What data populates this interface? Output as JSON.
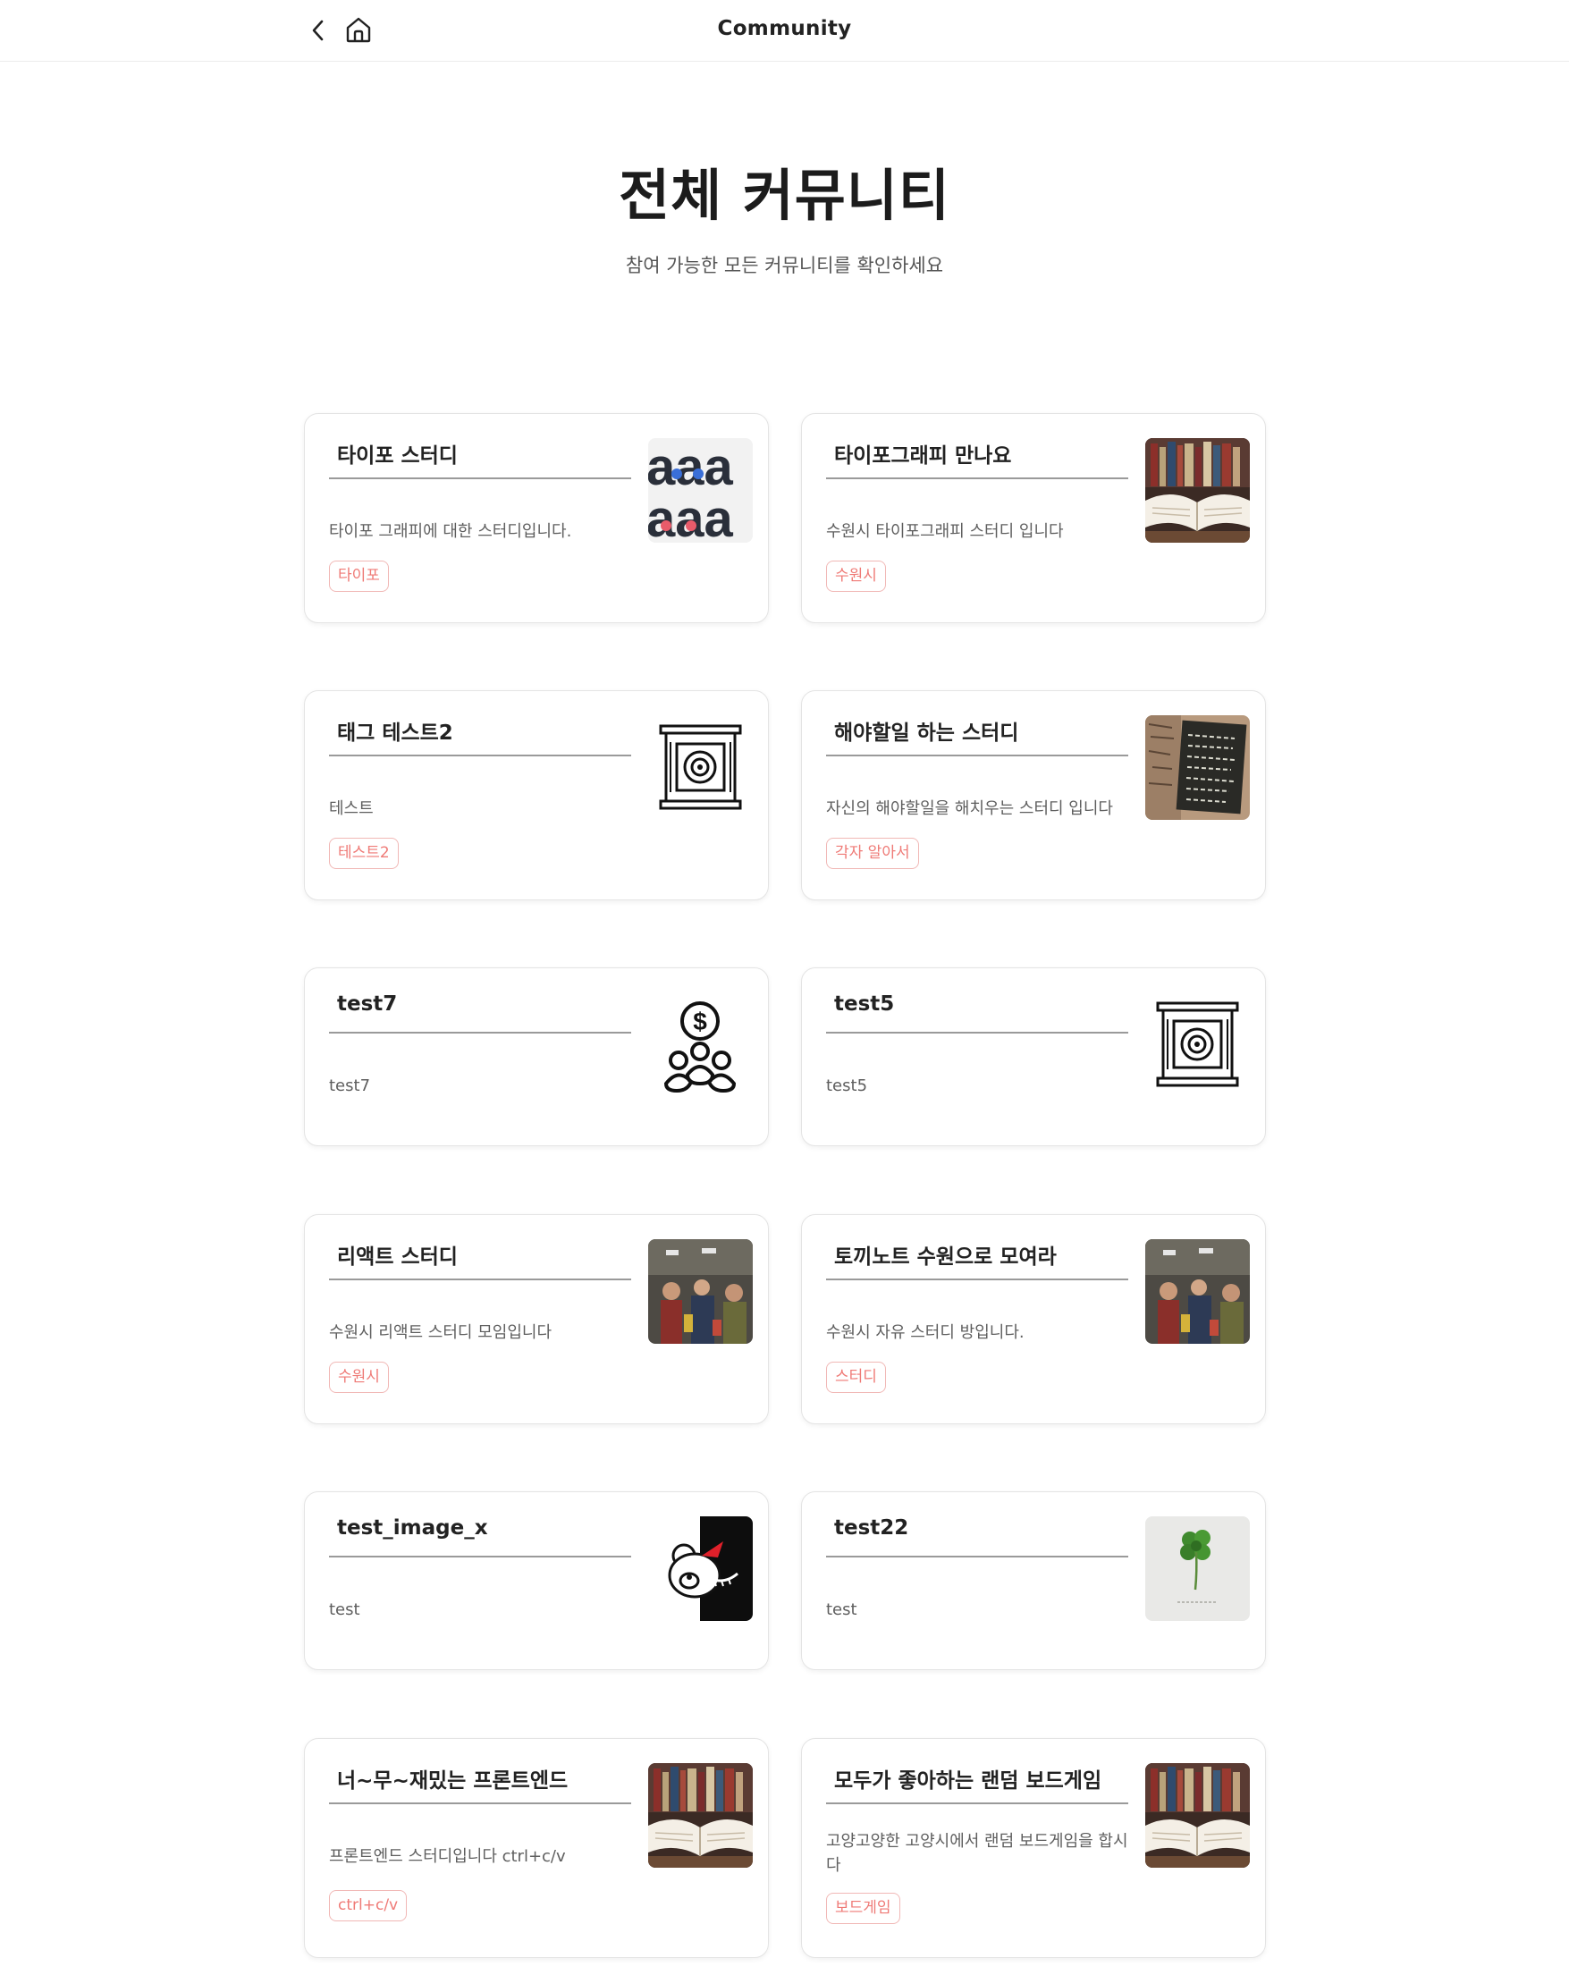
{
  "header": {
    "title": "Community",
    "back_icon": "chevron-left-icon",
    "home_icon": "home-icon"
  },
  "hero": {
    "title": "전체 커뮤니티",
    "subtitle": "참여 가능한 모든 커뮤니티를 확인하세요"
  },
  "colors": {
    "tag_text": "#ef7a76",
    "tag_border": "#f1b8b6",
    "card_border": "#e4e4e4",
    "title_text": "#222222"
  },
  "communities": [
    {
      "title": "타이포 스터디",
      "desc": "타이포 그래피에 대한 스터디입니다.",
      "tag": "타이포",
      "image": "letters-aaa-image"
    },
    {
      "title": "타이포그래피 만나요",
      "desc": "수원시 타이포그래피 스터디 입니다",
      "tag": "수원시",
      "image": "open-book-image"
    },
    {
      "title": "태그 테스트2",
      "desc": "테스트",
      "tag": "테스트2",
      "image": "vault-icon-image"
    },
    {
      "title": "해야할일 하는 스터디",
      "desc": "자신의 해야할일을 해치우는 스터디 입니다",
      "tag": "각자 알아서",
      "image": "chalkboard-photo"
    },
    {
      "title": "test7",
      "desc": "test7",
      "tag": "",
      "image": "money-group-icon-image"
    },
    {
      "title": "test5",
      "desc": "test5",
      "tag": "",
      "image": "vault-icon-image"
    },
    {
      "title": "리액트 스터디",
      "desc": "수원시 리액트 스터디 모임입니다",
      "tag": "수원시",
      "image": "street-photo"
    },
    {
      "title": "토끼노트 수원으로 모여라",
      "desc": "수원시 자유 스터디 방입니다.",
      "tag": "스터디",
      "image": "street-photo"
    },
    {
      "title": "test_image_x",
      "desc": "test",
      "tag": "",
      "image": "bear-character-image"
    },
    {
      "title": "test22",
      "desc": "test",
      "tag": "",
      "image": "clover-image"
    },
    {
      "title": "너~무~재밌는 프론트엔드",
      "desc": "프론트엔드 스터디입니다 ctrl+c/v",
      "tag": "ctrl+c/v",
      "image": "open-book-image"
    },
    {
      "title": "모두가 좋아하는 랜덤 보드게임",
      "desc": "고양고양한 고양시에서 랜덤 보드게임을 합시다",
      "tag": "보드게임",
      "image": "open-book-image"
    }
  ]
}
